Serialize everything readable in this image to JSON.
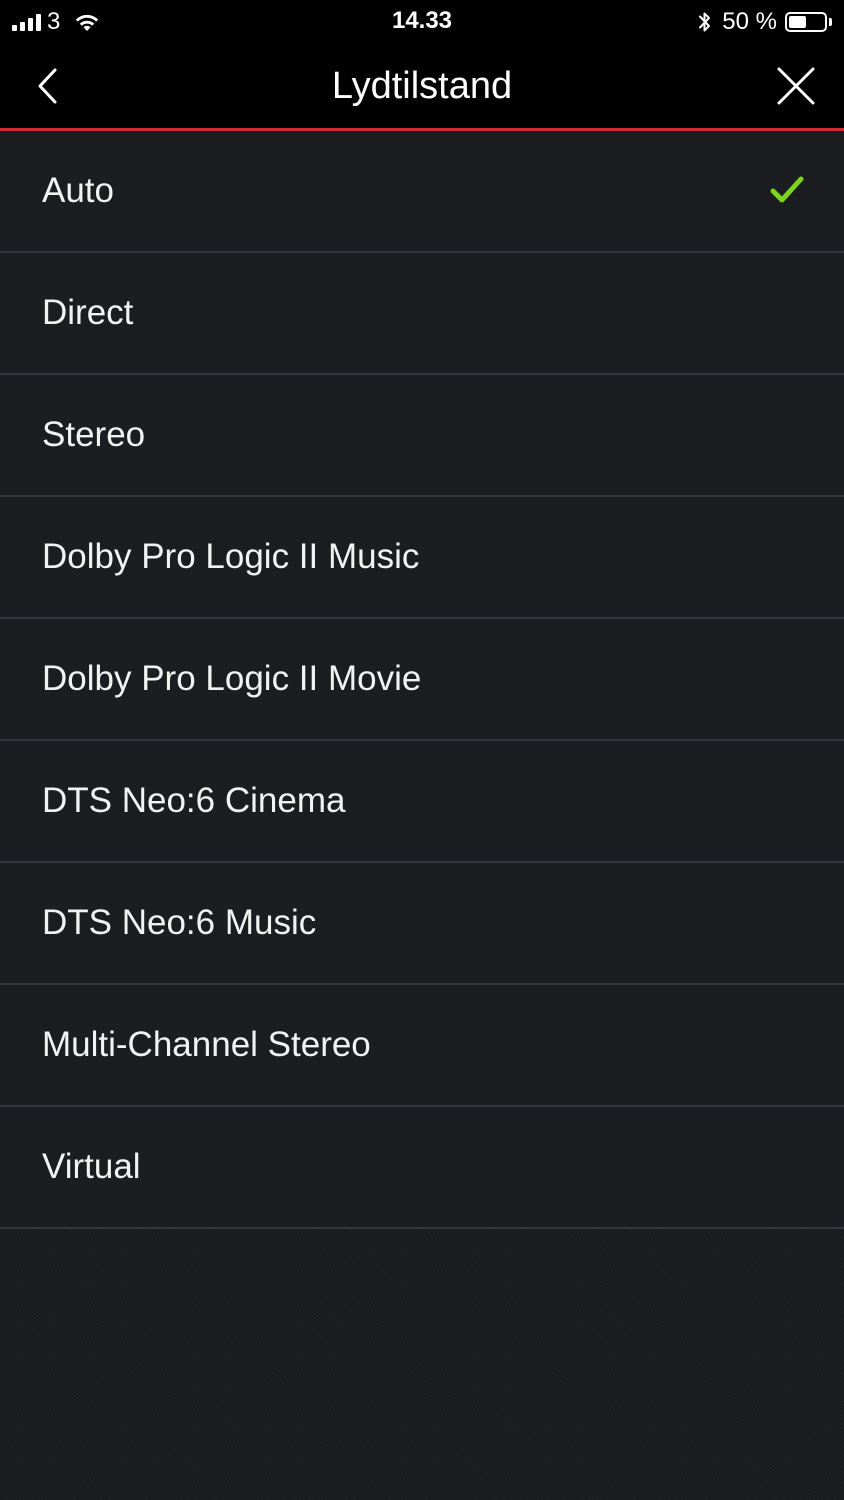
{
  "status_bar": {
    "carrier": "3",
    "time": "14.33",
    "battery_percent": "50 %",
    "battery_level": 0.5
  },
  "header": {
    "title": "Lydtilstand",
    "back_icon": "chevron-left-icon",
    "close_icon": "close-icon"
  },
  "modes": [
    {
      "label": "Auto",
      "selected": true
    },
    {
      "label": "Direct",
      "selected": false
    },
    {
      "label": "Stereo",
      "selected": false
    },
    {
      "label": "Dolby Pro Logic II Music",
      "selected": false
    },
    {
      "label": "Dolby Pro Logic II Movie",
      "selected": false
    },
    {
      "label": "DTS Neo:6 Cinema",
      "selected": false
    },
    {
      "label": "DTS Neo:6 Music",
      "selected": false
    },
    {
      "label": "Multi-Channel Stereo",
      "selected": false
    },
    {
      "label": "Virtual",
      "selected": false
    }
  ],
  "colors": {
    "accent_line": "#d32a2a",
    "checkmark": "#7ed321",
    "background": "#1c1d20"
  }
}
